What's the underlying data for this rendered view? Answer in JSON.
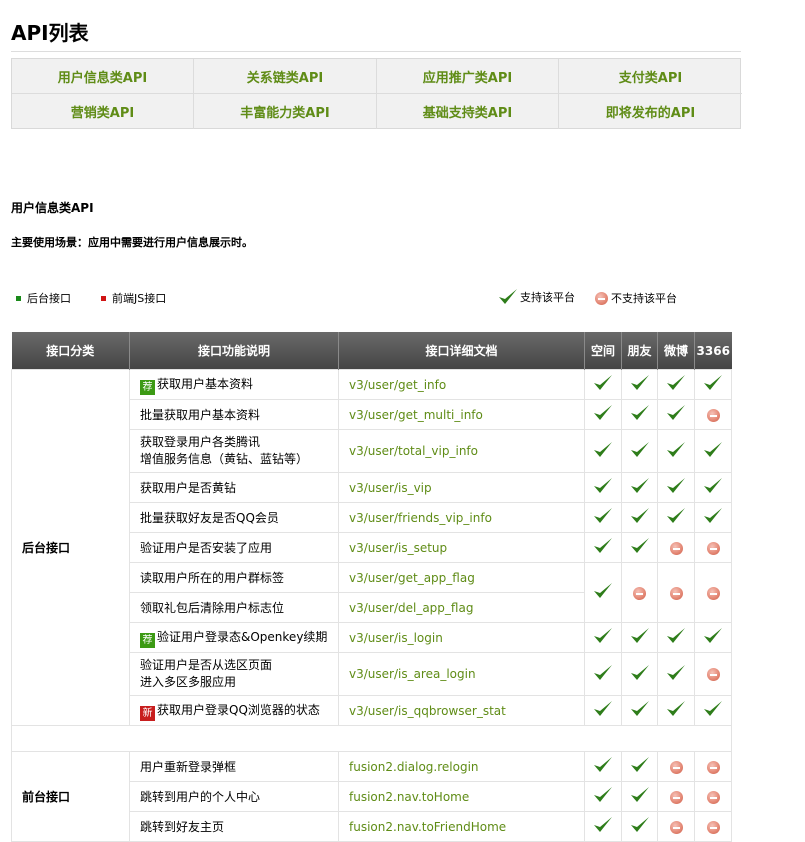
{
  "page": {
    "title": "API列表"
  },
  "categories": [
    "用户信息类API",
    "关系链类API",
    "应用推广类API",
    "支付类API",
    "营销类API",
    "丰富能力类API",
    "基础支持类API",
    "即将发布的API"
  ],
  "section": {
    "title": "用户信息类API",
    "scene": "主要使用场景：应用中需要进行用户信息展示时。"
  },
  "legend": {
    "backend": "后台接口",
    "frontend": "前端JS接口",
    "supported": "支持该平台",
    "unsupported": "不支持该平台"
  },
  "colors": {
    "link_green": "#5f8c16",
    "check_green": "#2e7d1a",
    "header_gray": "#555555"
  },
  "table": {
    "headers": [
      "接口分类",
      "接口功能说明",
      "接口详细文档",
      "空间",
      "朋友",
      "微博",
      "3366"
    ],
    "badges": {
      "rec": "荐",
      "new": "新"
    },
    "groups": [
      {
        "label": "后台接口",
        "rows": [
          {
            "desc": "获取用户基本资料",
            "badge": "rec",
            "doc": "v3/user/get_info",
            "support": [
              1,
              1,
              1,
              1
            ]
          },
          {
            "desc": "批量获取用户基本资料",
            "doc": "v3/user/get_multi_info",
            "support": [
              1,
              1,
              1,
              0
            ]
          },
          {
            "desc": "获取登录用户各类腾讯\n增值服务信息（黄钻、蓝钻等）",
            "doc": "v3/user/total_vip_info",
            "support": [
              1,
              1,
              1,
              1
            ],
            "tall": true
          },
          {
            "desc": "获取用户是否黄钻",
            "doc": "v3/user/is_vip",
            "support": [
              1,
              1,
              1,
              1
            ]
          },
          {
            "desc": "批量获取好友是否QQ会员",
            "doc": "v3/user/friends_vip_info",
            "support": [
              1,
              1,
              1,
              1
            ]
          },
          {
            "desc": "验证用户是否安装了应用",
            "doc": "v3/user/is_setup",
            "support": [
              1,
              1,
              0,
              0
            ]
          },
          {
            "desc": "读取用户所在的用户群标签",
            "doc": "v3/user/get_app_flag",
            "support": [
              1,
              0,
              0,
              0
            ],
            "merge": 2
          },
          {
            "desc": "领取礼包后清除用户标志位",
            "doc": "v3/user/del_app_flag"
          },
          {
            "desc": "验证用户登录态&Openkey续期",
            "badge": "rec",
            "doc": "v3/user/is_login",
            "support": [
              1,
              1,
              1,
              1
            ]
          },
          {
            "desc": "验证用户是否从选区页面\n进入多区多服应用",
            "doc": "v3/user/is_area_login",
            "support": [
              1,
              1,
              1,
              0
            ],
            "tall": true
          },
          {
            "desc": "获取用户登录QQ浏览器的状态",
            "badge": "new",
            "doc": "v3/user/is_qqbrowser_stat",
            "support": [
              1,
              1,
              1,
              1
            ]
          }
        ]
      },
      {
        "label": "前台接口",
        "rows": [
          {
            "desc": "用户重新登录弹框",
            "doc": "fusion2.dialog.relogin",
            "support": [
              1,
              1,
              0,
              0
            ]
          },
          {
            "desc": "跳转到用户的个人中心",
            "doc": "fusion2.nav.toHome",
            "support": [
              1,
              1,
              0,
              0
            ]
          },
          {
            "desc": "跳转到好友主页",
            "doc": "fusion2.nav.toFriendHome",
            "support": [
              1,
              1,
              0,
              0
            ]
          }
        ]
      }
    ]
  }
}
